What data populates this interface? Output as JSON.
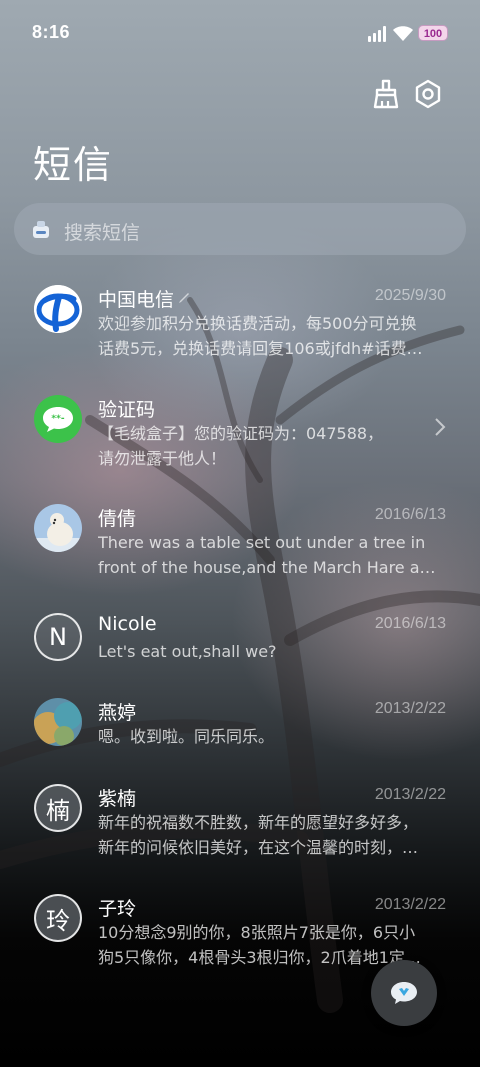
{
  "status_bar": {
    "time": "8:16",
    "battery": "100"
  },
  "header": {
    "title": "短信"
  },
  "search": {
    "placeholder": "搜索短信"
  },
  "conversations": [
    {
      "name": "中国电信",
      "date": "2025/9/30",
      "avatar": "china-telecom-logo",
      "line1": "欢迎参加积分兑换话费活动，每500分可兑换",
      "line2": "话费5元，兑换话费请回复106或jfdh#话费…"
    },
    {
      "name": "验证码",
      "date": "",
      "avatar": "message-bubble-icon",
      "line1": "【毛绒盒子】您的验证码为：047588，",
      "line2": "请勿泄露于他人！"
    },
    {
      "name": "倩倩",
      "date": "2016/6/13",
      "avatar": "polar-bear-photo",
      "line1": "There was a table set out under a tree in",
      "line2": "front of the house,and the March Hare an…"
    },
    {
      "name": "Nicole",
      "date": "2016/6/13",
      "avatar_letter": "N",
      "line1": "Let's eat out,shall we?",
      "line2": ""
    },
    {
      "name": "燕婷",
      "date": "2013/2/22",
      "avatar": "landscape-photo",
      "line1": "嗯。收到啦。同乐同乐。",
      "line2": ""
    },
    {
      "name": "紫楠",
      "date": "2013/2/22",
      "avatar_letter": "楠",
      "line1": "新年的祝福数不胜数，新年的愿望好多好多，",
      "line2": "新年的问候依旧美好，在这个温馨的时刻，…"
    },
    {
      "name": "子玲",
      "date": "2013/2/22",
      "avatar_letter": "玲",
      "line1": "10分想念9别的你，8张照片7张是你，6只小",
      "line2": "狗5只像你，4根骨头3根归你，2爪着地1定…"
    }
  ],
  "colors": {
    "telecom_blue": "#1463d6",
    "verify_green": "#3cc24a"
  }
}
